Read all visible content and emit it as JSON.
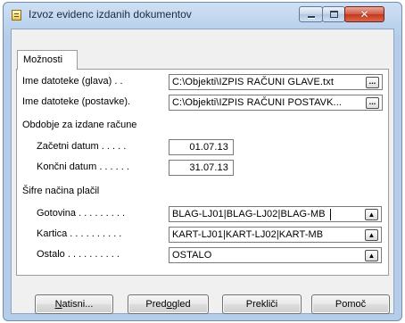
{
  "window": {
    "title": "Izvoz evidenc izdanih dokumentov",
    "controls": {
      "minimize_icon": "minimize-icon",
      "maximize_icon": "maximize-icon",
      "close_glyph": "✕"
    }
  },
  "tabs": [
    {
      "label": "Možnosti"
    }
  ],
  "files": {
    "header_label": "Ime datoteke (glava) . .",
    "header_value": "C:\\Objekti\\IZPIS RAČUNI GLAVE.txt",
    "lines_label": "Ime datoteke (postavke).",
    "lines_value": "C:\\Objekti\\IZPIS RAČUNI POSTAVK...",
    "browse_glyph": "..."
  },
  "period": {
    "section_label": "Obdobje za izdane račune",
    "start_label": "Začetni datum . . . . .",
    "start_value": "01.07.13",
    "end_label": "Končni datum . . . . . .",
    "end_value": "31.07.13"
  },
  "payment_codes": {
    "section_label": "Šifre načina plačil",
    "rows": [
      {
        "label": "Gotovina . . . . . . . . .",
        "value": "BLAG-LJ01|BLAG-LJ02|BLAG-MB"
      },
      {
        "label": "Kartica . . . . . . . . . .",
        "value": "KART-LJ01|KART-LJ02|KART-MB"
      },
      {
        "label": "Ostalo . . . . . . . . . .",
        "value": "OSTALO"
      }
    ],
    "lookup_glyph": "▲"
  },
  "buttons": {
    "print_pre": "",
    "print_key": "N",
    "print_post": "atisni...",
    "preview_pre": "Pred",
    "preview_key": "o",
    "preview_post": "gled",
    "cancel_label": "Prekliči",
    "help_label": "Pomoč"
  }
}
